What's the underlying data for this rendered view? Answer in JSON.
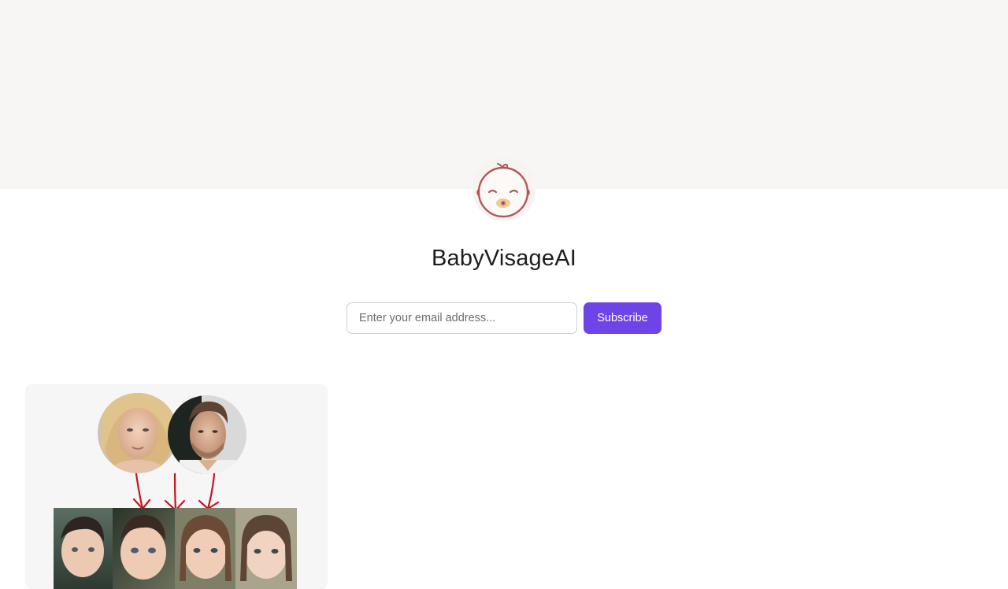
{
  "site": {
    "title": "BabyVisageAI",
    "logo_icon": "baby-face-icon"
  },
  "subscribe": {
    "email_placeholder": "Enter your email address...",
    "email_value": "",
    "button_label": "Subscribe"
  },
  "colors": {
    "banner_bg": "#f7f6f5",
    "accent": "#6e44e6",
    "logo_stroke": "#b25656",
    "arrow": "#c4151b"
  },
  "preview_card": {
    "parent_photos": [
      "mother-photo",
      "father-photo"
    ],
    "child_photos": [
      "child-photo-1",
      "child-photo-2",
      "child-photo-3",
      "child-photo-4"
    ],
    "arrow_icon": "arrow-down-icon"
  }
}
